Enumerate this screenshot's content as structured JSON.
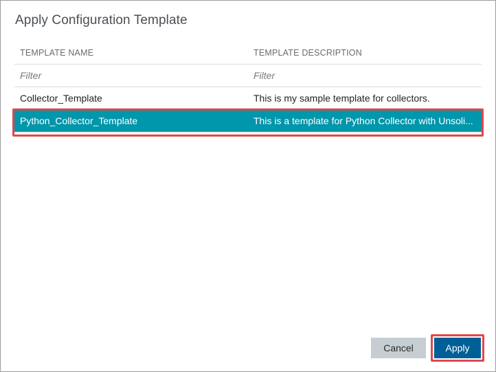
{
  "dialog": {
    "title": "Apply Configuration Template"
  },
  "table": {
    "columns": [
      "TEMPLATE NAME",
      "TEMPLATE DESCRIPTION"
    ],
    "filters": {
      "name_placeholder": "Filter",
      "description_placeholder": "Filter"
    },
    "rows": [
      {
        "name": "Collector_Template",
        "description": "This is my sample template for collectors.",
        "selected": false
      },
      {
        "name": "Python_Collector_Template",
        "description": "This is a template for Python Collector with Unsoli...",
        "selected": true
      }
    ]
  },
  "buttons": {
    "cancel_label": "Cancel",
    "apply_label": "Apply"
  },
  "colors": {
    "selected_row": "#0096ab",
    "apply_button": "#005f96",
    "cancel_button": "#c6ced3",
    "highlight": "#e0474c"
  }
}
